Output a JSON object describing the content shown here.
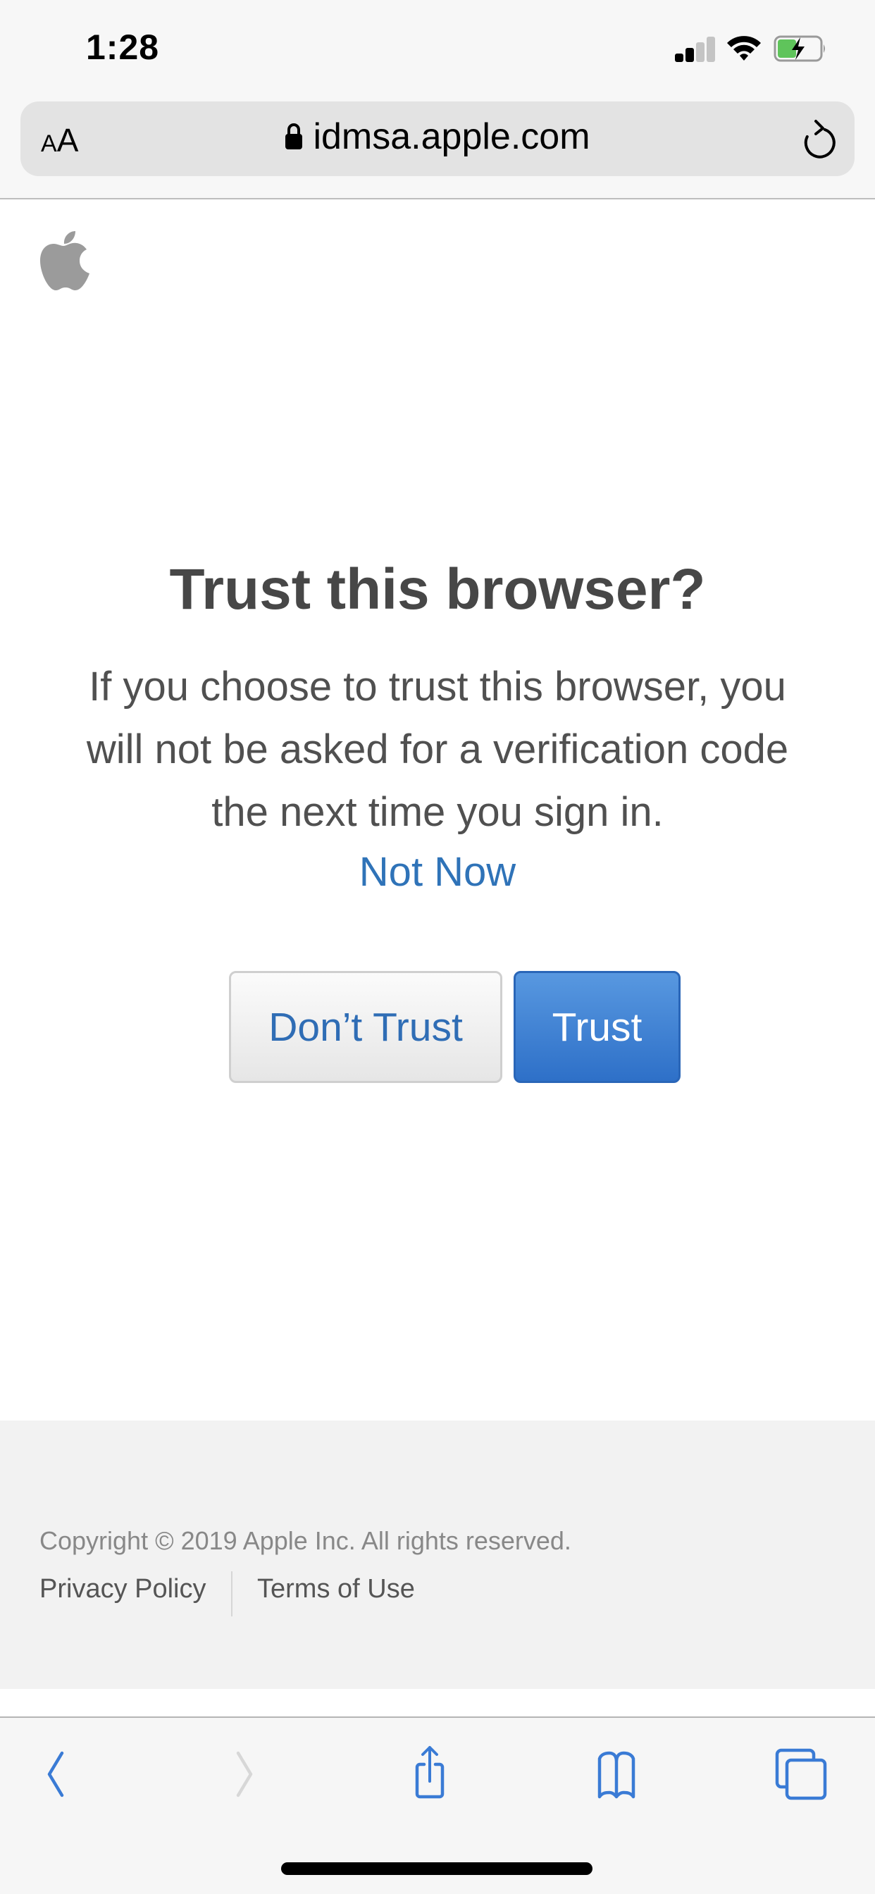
{
  "status_bar": {
    "time": "1:28",
    "signal_bars_filled": 2,
    "signal_bars_total": 4,
    "wifi_icon": "wifi-icon",
    "battery_level": 0.45,
    "battery_charging": true,
    "battery_color": "#5fc45b"
  },
  "address_bar": {
    "text_size_label_small": "A",
    "text_size_label_large": "A",
    "lock_icon": "lock-icon",
    "url": "idmsa.apple.com",
    "reload_icon": "reload-icon"
  },
  "page": {
    "logo": "apple-logo",
    "heading": "Trust this browser?",
    "body": "If you choose to trust this browser, you will not be asked for a verification code the next time you sign in.",
    "not_now_label": "Not Now",
    "dont_trust_label": "Don’t Trust",
    "trust_label": "Trust",
    "accent_color": "#2f73b8"
  },
  "footer": {
    "copyright": "Copyright © 2019 Apple Inc. All rights reserved.",
    "links": [
      {
        "label": "Privacy Policy"
      },
      {
        "label": "Terms of Use"
      }
    ]
  },
  "toolbar": {
    "items": [
      {
        "icon": "back-icon",
        "enabled": true
      },
      {
        "icon": "forward-icon",
        "enabled": false
      },
      {
        "icon": "share-icon",
        "enabled": true
      },
      {
        "icon": "bookmarks-icon",
        "enabled": true
      },
      {
        "icon": "tabs-icon",
        "enabled": true
      }
    ],
    "icon_color": "#3a7bd5"
  }
}
